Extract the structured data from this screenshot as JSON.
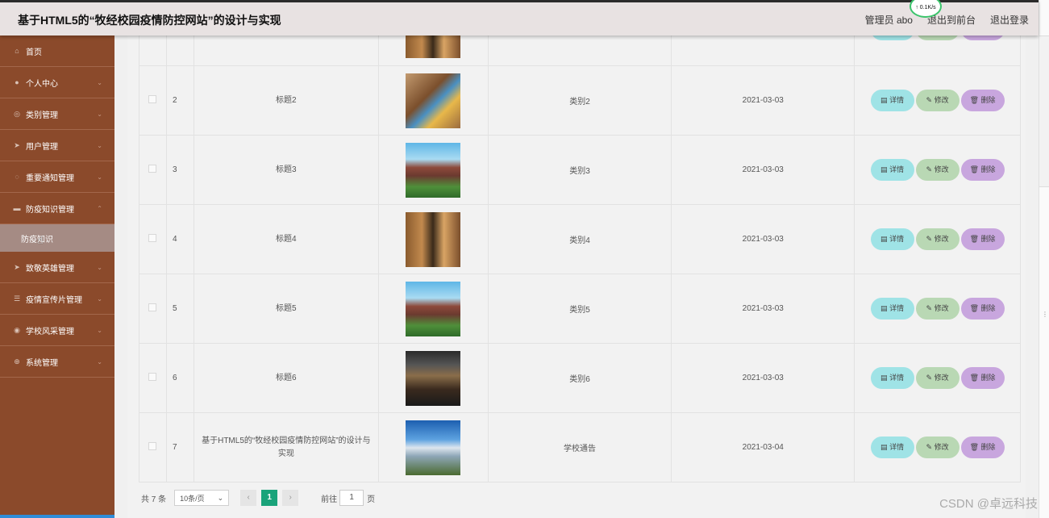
{
  "header": {
    "title": "基于HTML5的“牧经校园疫情防控网站”的设计与实现",
    "admin": "管理员 abo",
    "back_front": "退出到前台",
    "logout": "退出登录",
    "net_speed": "↑ 0.1K/s"
  },
  "sidebar": {
    "items": [
      {
        "label": "首页",
        "icon": "home-icon"
      },
      {
        "label": "个人中心",
        "icon": "user-icon"
      },
      {
        "label": "类别管理",
        "icon": "category-icon"
      },
      {
        "label": "用户管理",
        "icon": "send-icon"
      },
      {
        "label": "重要通知管理",
        "icon": "bell-icon"
      },
      {
        "label": "防疫知识管理",
        "icon": "message-icon"
      },
      {
        "label": "致敬英雄管理",
        "icon": "send-icon"
      },
      {
        "label": "疫情宣传片管理",
        "icon": "sliders-icon"
      },
      {
        "label": "学校风采管理",
        "icon": "camera-icon"
      },
      {
        "label": "系统管理",
        "icon": "globe-icon"
      }
    ],
    "submenu_label": "防疫知识"
  },
  "table": {
    "rows": [
      {
        "index": "2",
        "title": "标题2",
        "category": "类别2",
        "date": "2021-03-03",
        "thumb": "t1"
      },
      {
        "index": "3",
        "title": "标题3",
        "category": "类别3",
        "date": "2021-03-03",
        "thumb": "t2"
      },
      {
        "index": "4",
        "title": "标题4",
        "category": "类别4",
        "date": "2021-03-03",
        "thumb": "t3"
      },
      {
        "index": "5",
        "title": "标题5",
        "category": "类别5",
        "date": "2021-03-03",
        "thumb": "t2"
      },
      {
        "index": "6",
        "title": "标题6",
        "category": "类别6",
        "date": "2021-03-03",
        "thumb": "t4"
      },
      {
        "index": "7",
        "title": "基于HTML5的“牧经校园疫情防控网站”的设计与实现",
        "category": "学校通告",
        "date": "2021-03-04",
        "thumb": "t5"
      }
    ],
    "actions": {
      "detail": "详情",
      "edit": "修改",
      "delete": "删除"
    }
  },
  "pagination": {
    "total": "共 7 条",
    "page_size": "10条/页",
    "current_page": "1",
    "goto_label": "前往",
    "goto_value": "1",
    "page_unit": "页"
  },
  "watermark": "CSDN @卓远科技"
}
